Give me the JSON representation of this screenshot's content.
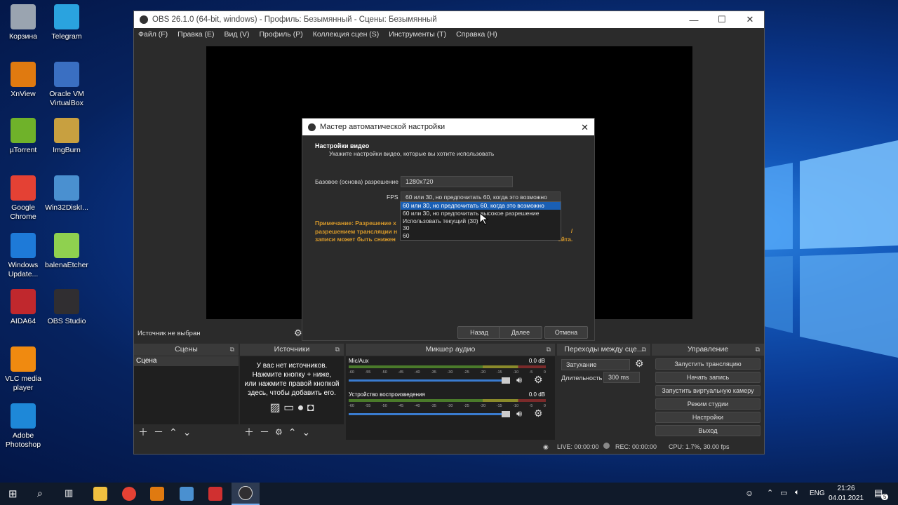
{
  "desktop": {
    "icons": [
      {
        "label": "Корзина",
        "icon": "recycle-bin-icon",
        "color": "#9aa4b0"
      },
      {
        "label": "Telegram",
        "icon": "telegram-icon",
        "color": "#2aa3df"
      },
      {
        "label": "XnView",
        "icon": "xnview-icon",
        "color": "#e07a10"
      },
      {
        "label": "Oracle VM VirtualBox",
        "icon": "virtualbox-icon",
        "color": "#3a6fc2"
      },
      {
        "label": "µTorrent",
        "icon": "utorrent-icon",
        "color": "#6fb22a"
      },
      {
        "label": "ImgBurn",
        "icon": "imgburn-icon",
        "color": "#c8a040"
      },
      {
        "label": "Google Chrome",
        "icon": "chrome-icon",
        "color": "#e44134"
      },
      {
        "label": "Win32DiskI...",
        "icon": "win32diskimager-icon",
        "color": "#4a90d0"
      },
      {
        "label": "Windows Update...",
        "icon": "windows-update-icon",
        "color": "#1e7ad8"
      },
      {
        "label": "balenaEtcher",
        "icon": "balenaetcher-icon",
        "color": "#8fd14f"
      },
      {
        "label": "AIDA64",
        "icon": "aida64-icon",
        "color": "#c0282d"
      },
      {
        "label": "OBS Studio",
        "icon": "obs-icon",
        "color": "#302e31"
      },
      {
        "label": "VLC media player",
        "icon": "vlc-icon",
        "color": "#f08a10"
      },
      {
        "label": "Adobe Photoshop",
        "icon": "photoshop-icon",
        "color": "#1e88d8"
      }
    ]
  },
  "obs": {
    "title": "OBS 26.1.0 (64-bit, windows) - Профиль: Безымянный - Сцены: Безымянный",
    "menu": [
      "Файл (F)",
      "Правка (E)",
      "Вид (V)",
      "Профиль (P)",
      "Коллекция сцен (S)",
      "Инструменты (T)",
      "Справка (H)"
    ],
    "source_bar": {
      "label": "Источник не выбран"
    },
    "docks": {
      "scenes": {
        "title": "Сцены",
        "items": [
          "Сцена"
        ]
      },
      "sources": {
        "title": "Источники",
        "empty_text": "У вас нет источников.\nНажмите кнопку + ниже,\nили нажмите правой кнопкой\nздесь, чтобы добавить его."
      },
      "mixer": {
        "title": "Микшер аудио",
        "channels": [
          {
            "name": "Mic/Aux",
            "db": "0.0 dB",
            "level": 0
          },
          {
            "name": "Устройство воспроизведения",
            "db": "0.0 dB",
            "level": 0
          }
        ],
        "scale": [
          "-60",
          "-55",
          "-50",
          "-45",
          "-40",
          "-35",
          "-30",
          "-25",
          "-20",
          "-15",
          "-10",
          "-5",
          "0"
        ]
      },
      "transitions": {
        "title": "Переходы между сце...",
        "transition": "Затухание",
        "duration_label": "Длительность",
        "duration": "300 ms"
      },
      "controls": {
        "title": "Управление",
        "buttons": [
          "Запустить трансляцию",
          "Начать запись",
          "Запустить виртуальную камеру",
          "Режим студии",
          "Настройки",
          "Выход"
        ]
      }
    },
    "status": {
      "live": "LIVE: 00:00:00",
      "rec": "REC: 00:00:00",
      "cpu": "CPU: 1.7%, 30.00 fps"
    }
  },
  "dialog": {
    "title": "Мастер автоматической настройки",
    "heading": "Настройки видео",
    "subheading": "Укажите настройки видео, которые вы хотите использовать",
    "resolution_label": "Базовое (основа) разрешение",
    "resolution_value": "1280x720",
    "fps_label": "FPS",
    "fps_value": "60 или 30, но предпочитать 60, когда это возможно",
    "fps_options": [
      "60 или 30, но предпочитать 60, когда это возможно",
      "60 или 30, но предпочитать высокое разрешение",
      "Использовать текущий (30)",
      "30",
      "60"
    ],
    "fps_highlighted_index": 0,
    "note_line1": "Примечание: Разрешение х",
    "note_line1_tail": "/",
    "note_line2": "разрешением трансляции н",
    "note_line2_tail": "/",
    "note_line3": "записи может быть снижен",
    "note_line3_tail": "ейта.",
    "buttons": {
      "back": "Назад",
      "next": "Далее",
      "cancel": "Отмена"
    }
  },
  "taskbar": {
    "lang": "ENG",
    "time": "21:26",
    "date": "04.01.2021",
    "notifications": "5"
  },
  "colors": {
    "note": "#d99a2a",
    "highlight": "#1a5fb4",
    "accent": "#2f8be8"
  }
}
